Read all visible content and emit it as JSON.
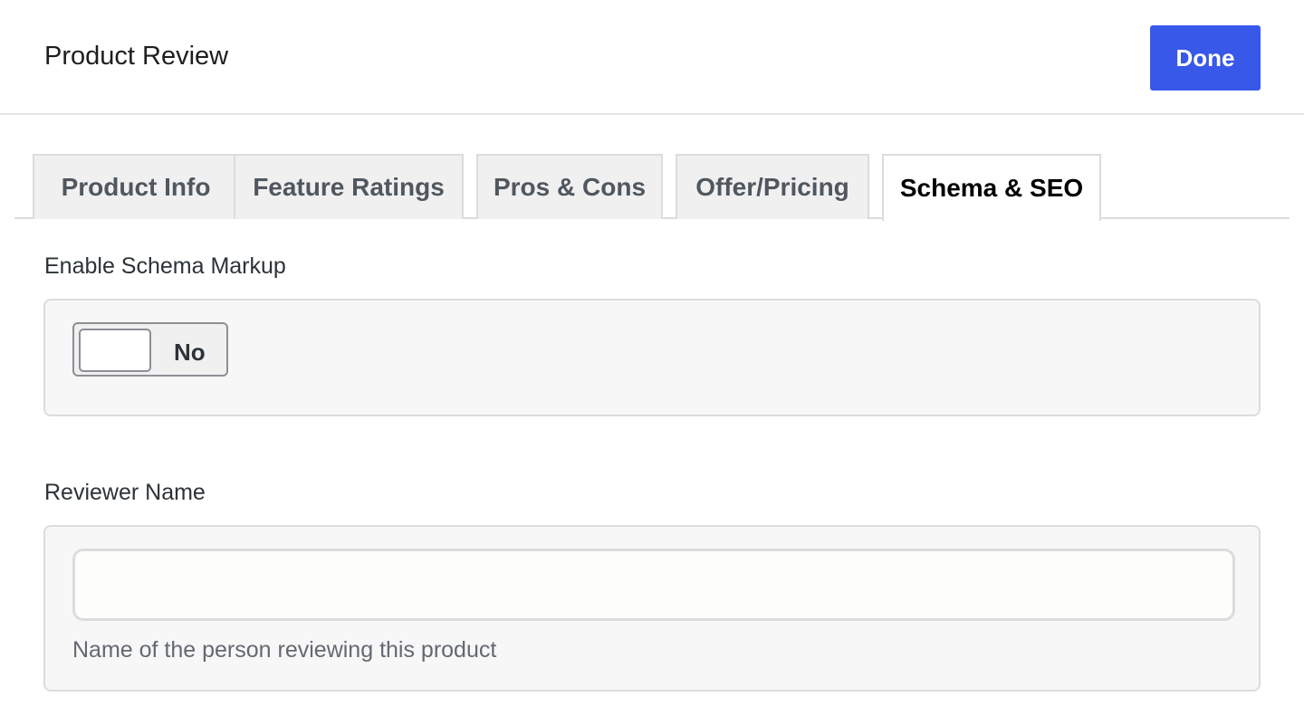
{
  "modal": {
    "title": "Product Review",
    "done_label": "Done"
  },
  "tabs": [
    {
      "label": "Product Info",
      "active": false
    },
    {
      "label": "Feature Ratings",
      "active": false
    },
    {
      "label": "Pros & Cons",
      "active": false
    },
    {
      "label": "Offer/Pricing",
      "active": false
    },
    {
      "label": "Schema & SEO",
      "active": true
    }
  ],
  "fields": {
    "schema": {
      "label": "Enable Schema Markup",
      "toggle_text": "No",
      "enabled": false
    },
    "reviewer": {
      "label": "Reviewer Name",
      "value": "",
      "placeholder": "",
      "help": "Name of the person reviewing this product"
    }
  },
  "colors": {
    "accent": "#3858e9",
    "tab_bg": "#f0f0f1",
    "border": "#dcdcde",
    "panel_bg": "#f7f7f7",
    "help_text": "#646970"
  }
}
